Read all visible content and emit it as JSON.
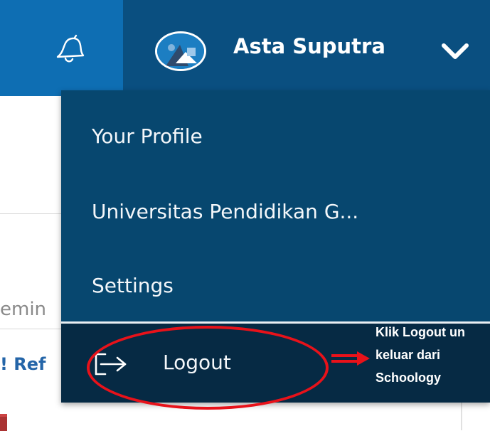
{
  "header": {
    "user_name": "Asta Suputra"
  },
  "icons": {
    "bell": "bell-icon",
    "avatar": "avatar",
    "chevron": "chevron-down-icon",
    "logout": "logout-icon"
  },
  "dropdown": {
    "items": [
      {
        "label": "Your Profile"
      },
      {
        "label": "Universitas Pendidikan G..."
      },
      {
        "label": "Settings"
      }
    ],
    "logout_label": "Logout"
  },
  "background": {
    "remind_fragment": "emin",
    "refresh_fragment": "! Ref"
  },
  "annotation": {
    "lines": [
      "Klik Logout un",
      "keluar dari",
      "Schoology"
    ],
    "color": "#e8121a"
  },
  "colors": {
    "header_bg": "#0a4f80",
    "bell_bg": "#0e6eb3",
    "dropdown_bg": "#07476f",
    "logout_bg": "#062a44"
  }
}
